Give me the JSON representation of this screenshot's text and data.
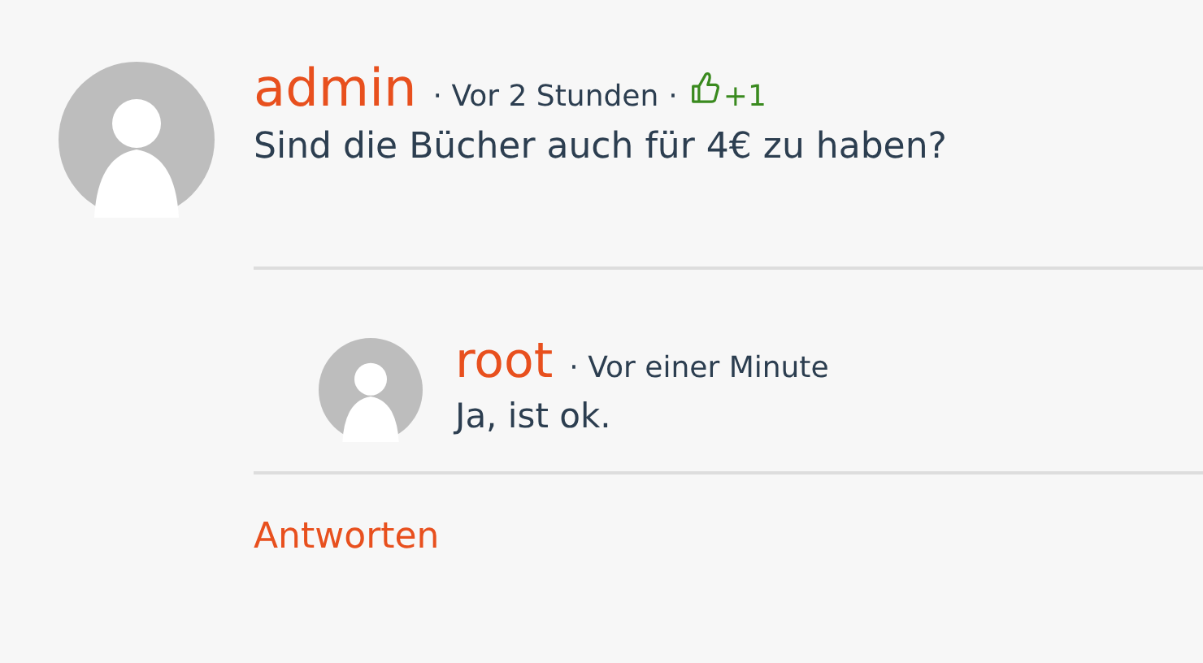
{
  "comment": {
    "author": "admin",
    "time": "· Vor 2 Stunden",
    "separator": "·",
    "likes": "+1",
    "text": "Sind die Bücher auch für 4€ zu haben?"
  },
  "replies": [
    {
      "author": "root",
      "time": "· Vor einer Minute",
      "text": "Ja, ist ok."
    }
  ],
  "reply_link": "Antworten"
}
